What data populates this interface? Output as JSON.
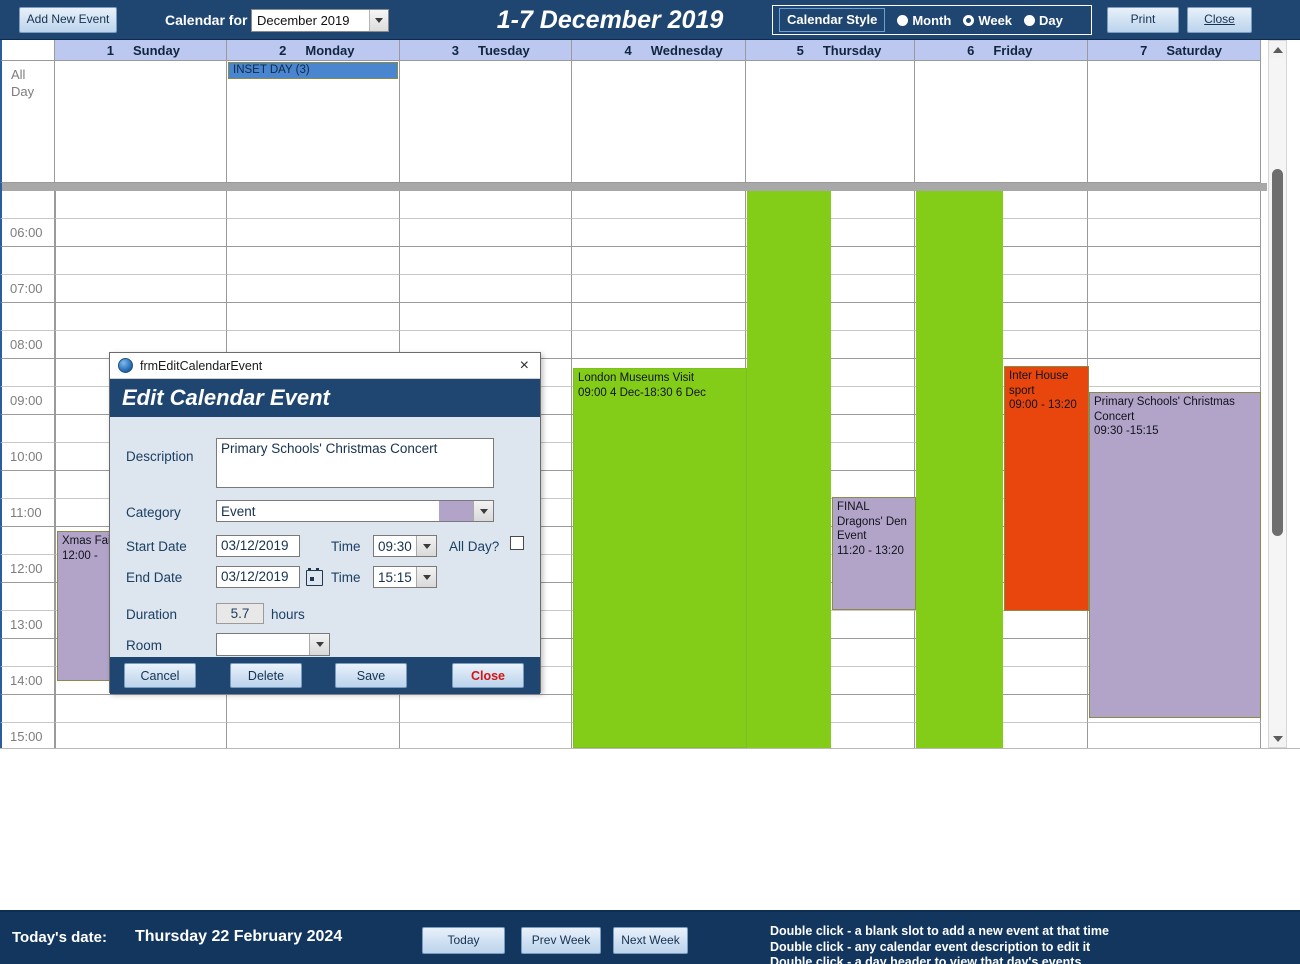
{
  "toolbar": {
    "add_new_event": "Add New Event",
    "calendar_for_label": "Calendar for",
    "month_value": "December 2019",
    "week_title": "1-7 December 2019",
    "style_legend": "Calendar Style",
    "style_options": [
      "Month",
      "Week",
      "Day"
    ],
    "style_selected": "Week",
    "print": "Print",
    "close": "Close"
  },
  "grid": {
    "allday_label": "All\nDay",
    "allday_label_line1": "All",
    "allday_label_line2": "Day",
    "days": [
      {
        "num": "1",
        "name": "Sunday"
      },
      {
        "num": "2",
        "name": "Monday"
      },
      {
        "num": "3",
        "name": "Tuesday"
      },
      {
        "num": "4",
        "name": "Wednesday"
      },
      {
        "num": "5",
        "name": "Thursday"
      },
      {
        "num": "6",
        "name": "Friday"
      },
      {
        "num": "7",
        "name": "Saturday"
      }
    ],
    "time_labels": [
      "",
      "06:00",
      "",
      "07:00",
      "",
      "08:00",
      "",
      "09:00",
      "",
      "10:00",
      "",
      "11:00",
      "",
      "12:00",
      "",
      "13:00",
      "",
      "14:00",
      "",
      "15:00",
      ""
    ],
    "allday_events": [
      {
        "day": 1,
        "title": "INSET DAY (3)",
        "color": "#4a86d0"
      }
    ],
    "events": [
      {
        "name": "xmas-fair",
        "title": "Xmas Fai",
        "time": "12:00      -",
        "color": "#b2a3c9"
      },
      {
        "name": "london-museums-visit",
        "title": "London Museums Visit",
        "time": "09:00 4 Dec-18:30 6 Dec",
        "color": "#83cd19"
      },
      {
        "name": "final-dragons-den-event",
        "title": "FINAL Dragons' Den Event",
        "time": "11:20      -  13:20",
        "color": "#b2a3c9"
      },
      {
        "name": "inter-house-sport",
        "title": "Inter House sport",
        "time": "09:00      -  13:20",
        "color": "#e8460d"
      },
      {
        "name": "primary-schools-christmas-concert",
        "title": "Primary Schools' Christmas Concert",
        "time": "09:30      -15:15",
        "color": "#b2a3c9"
      }
    ]
  },
  "dialog": {
    "window_title": "frmEditCalendarEvent",
    "banner": "Edit Calendar Event",
    "close_x": "×",
    "labels": {
      "description": "Description",
      "category": "Category",
      "start_date": "Start Date",
      "end_date": "End Date",
      "time1": "Time",
      "time2": "Time",
      "all_day": "All Day?",
      "duration": "Duration",
      "duration_units": "hours",
      "room": "Room"
    },
    "values": {
      "description": "Primary Schools' Christmas Concert",
      "category": "Event",
      "category_swatch": "#b2a3c9",
      "start_date": "03/12/2019",
      "start_time": "09:30",
      "end_date": "03/12/2019",
      "end_time": "15:15",
      "duration": "5.7",
      "room": ""
    },
    "buttons": {
      "cancel": "Cancel",
      "delete": "Delete",
      "save": "Save",
      "close": "Close"
    }
  },
  "statusbar": {
    "todays_date_label": "Today's date:",
    "todays_date_value": "Thursday 22 February 2024",
    "today": "Today",
    "prev_week": "Prev Week",
    "next_week": "Next Week",
    "hints": [
      "Double click - a blank slot to add a new event at that time",
      "Double click - any calendar event description to edit it",
      "Double click - a day header to view that day's events"
    ]
  },
  "colors": {
    "toolbar_bg": "#1f4571",
    "header_row_bg": "#bcc8f0",
    "accent_green": "#83cd19",
    "accent_purple": "#b2a3c9",
    "accent_orange": "#e8460d",
    "accent_blue": "#4a86d0"
  }
}
